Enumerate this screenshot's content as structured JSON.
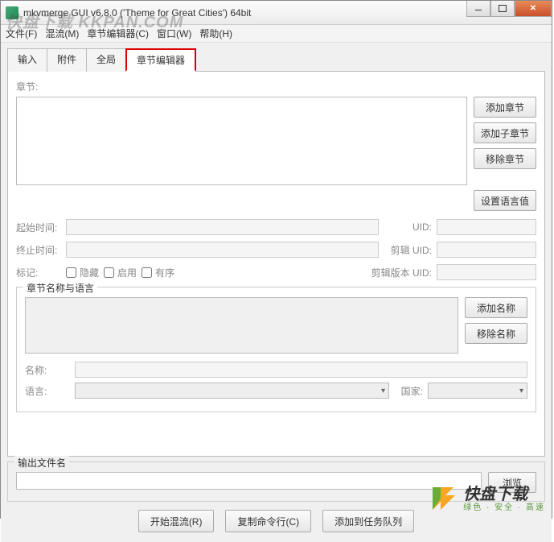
{
  "window": {
    "title": "mkvmerge GUI v6.8.0 ('Theme for Great Cities') 64bit"
  },
  "watermark": "快盘下载 KKPAN.COM",
  "menu": {
    "file": "文件(F)",
    "muxing": "混流(M)",
    "chapter_editor": "章节编辑器(C)",
    "window": "窗口(W)",
    "help": "帮助(H)"
  },
  "tabs": {
    "input": "输入",
    "attachments": "附件",
    "global": "全局",
    "chapter_editor": "章节编辑器"
  },
  "labels": {
    "chapters": "章节:",
    "start_time": "起始时间:",
    "end_time": "终止时间:",
    "flags": "标记:",
    "hidden": "隐藏",
    "enabled": "启用",
    "ordered": "有序",
    "uid": "UID:",
    "segment_uid": "剪辑 UID:",
    "segment_edition_uid": "剪辑版本 UID:",
    "name_lang_group": "章节名称与语言",
    "name": "名称:",
    "language": "语言:",
    "country": "国家:",
    "output_group": "输出文件名"
  },
  "buttons": {
    "add_chapter": "添加章节",
    "add_subchapter": "添加子章节",
    "remove_chapter": "移除章节",
    "set_values": "设置语言值",
    "add_name": "添加名称",
    "remove_name": "移除名称",
    "browse": "浏览",
    "start_muxing": "开始混流(R)",
    "copy_cmdline": "复制命令行(C)",
    "add_to_queue": "添加到任务队列"
  },
  "logo": {
    "main": "快盘下载",
    "sub": "绿色 · 安全 · 高速"
  }
}
